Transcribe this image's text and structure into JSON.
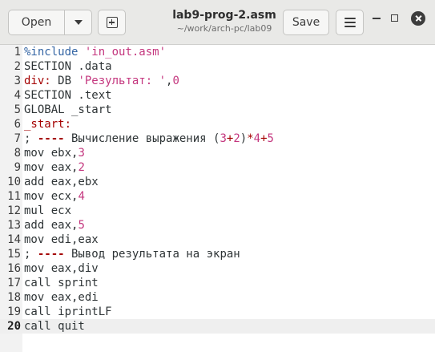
{
  "window": {
    "title": "lab9-prog-2.asm",
    "subtitle": "~/work/arch-pc/lab09"
  },
  "toolbar": {
    "open_label": "Open",
    "save_label": "Save"
  },
  "icons": {
    "open_menu": "chevron-down-icon",
    "new_tab": "new-tab-icon",
    "main_menu": "hamburger-menu-icon",
    "minimize": "minimize-icon",
    "maximize": "maximize-icon",
    "close": "close-icon"
  },
  "colors": {
    "preprocessor": "#3465a4",
    "string": "#c4367e",
    "number": "#c4367e",
    "label": "#a40000",
    "current_line": "#efefef"
  },
  "editor": {
    "current_line": 20,
    "lines": [
      {
        "n": "1",
        "tokens": [
          {
            "t": "%include",
            "c": "pre"
          },
          {
            "t": " "
          },
          {
            "t": "'in_out.asm'",
            "c": "str"
          }
        ]
      },
      {
        "n": "2",
        "tokens": [
          {
            "t": "SECTION .data"
          }
        ]
      },
      {
        "n": "3",
        "tokens": [
          {
            "t": "div:",
            "c": "lbl"
          },
          {
            "t": " DB "
          },
          {
            "t": "'Результат: '",
            "c": "str"
          },
          {
            "t": ","
          },
          {
            "t": "0",
            "c": "num"
          }
        ]
      },
      {
        "n": "4",
        "tokens": [
          {
            "t": "SECTION .text"
          }
        ]
      },
      {
        "n": "5",
        "tokens": [
          {
            "t": "GLOBAL _start"
          }
        ]
      },
      {
        "n": "6",
        "tokens": [
          {
            "t": "_start:",
            "c": "lbl"
          }
        ]
      },
      {
        "n": "7",
        "tokens": [
          {
            "t": "; "
          },
          {
            "t": "----",
            "c": "dash"
          },
          {
            "t": " Вычисление выражения ("
          },
          {
            "t": "3",
            "c": "num"
          },
          {
            "t": "+",
            "c": "plus"
          },
          {
            "t": "2",
            "c": "num"
          },
          {
            "t": ")"
          },
          {
            "t": "*",
            "c": "plus"
          },
          {
            "t": "4",
            "c": "num"
          },
          {
            "t": "+",
            "c": "plus"
          },
          {
            "t": "5",
            "c": "num"
          }
        ]
      },
      {
        "n": "8",
        "tokens": [
          {
            "t": "mov ebx,"
          },
          {
            "t": "3",
            "c": "num"
          }
        ]
      },
      {
        "n": "9",
        "tokens": [
          {
            "t": "mov eax,"
          },
          {
            "t": "2",
            "c": "num"
          }
        ]
      },
      {
        "n": "10",
        "tokens": [
          {
            "t": "add eax,ebx"
          }
        ]
      },
      {
        "n": "11",
        "tokens": [
          {
            "t": "mov ecx,"
          },
          {
            "t": "4",
            "c": "num"
          }
        ]
      },
      {
        "n": "12",
        "tokens": [
          {
            "t": "mul ecx"
          }
        ]
      },
      {
        "n": "13",
        "tokens": [
          {
            "t": "add eax,"
          },
          {
            "t": "5",
            "c": "num"
          }
        ]
      },
      {
        "n": "14",
        "tokens": [
          {
            "t": "mov edi,eax"
          }
        ]
      },
      {
        "n": "15",
        "tokens": [
          {
            "t": "; "
          },
          {
            "t": "----",
            "c": "dash"
          },
          {
            "t": " Вывод результата на экран"
          }
        ]
      },
      {
        "n": "16",
        "tokens": [
          {
            "t": "mov eax,div"
          }
        ]
      },
      {
        "n": "17",
        "tokens": [
          {
            "t": "call sprint"
          }
        ]
      },
      {
        "n": "18",
        "tokens": [
          {
            "t": "mov eax,edi"
          }
        ]
      },
      {
        "n": "19",
        "tokens": [
          {
            "t": "call iprintLF"
          }
        ]
      },
      {
        "n": "20",
        "tokens": [
          {
            "t": "call quit"
          }
        ]
      }
    ]
  }
}
